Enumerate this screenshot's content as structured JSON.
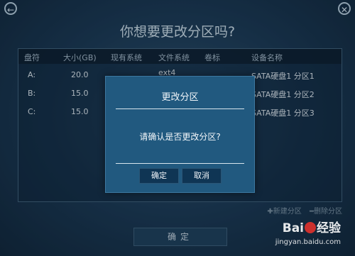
{
  "window": {
    "back_icon": "back-arrow-icon",
    "close_icon": "close-icon"
  },
  "title": "你想要更改分区吗?",
  "table": {
    "headers": [
      "盘符",
      "大小(GB)",
      "现有系统",
      "文件系统",
      "卷标",
      "设备名称"
    ],
    "rows": [
      {
        "drive": "A:",
        "size": "20.0",
        "system": "",
        "fs": "ext4",
        "label": "",
        "device": "SATA硬盘1 分区1"
      },
      {
        "drive": "B:",
        "size": "15.0",
        "system": "",
        "fs": "",
        "label": "",
        "device": "SATA硬盘1 分区2"
      },
      {
        "drive": "C:",
        "size": "15.0",
        "system": "",
        "fs": "",
        "label": "",
        "device": "SATA硬盘1 分区3"
      }
    ]
  },
  "ops": {
    "new_partition": "✚新建分区",
    "delete_partition": "━删除分区"
  },
  "confirm_button": "确定",
  "dialog": {
    "title": "更改分区",
    "message": "请确认是否更改分区?",
    "ok": "确定",
    "cancel": "取消"
  },
  "watermark": {
    "brand_left": "Bai",
    "brand_right": "经验",
    "url": "jingyan.baidu.com"
  }
}
